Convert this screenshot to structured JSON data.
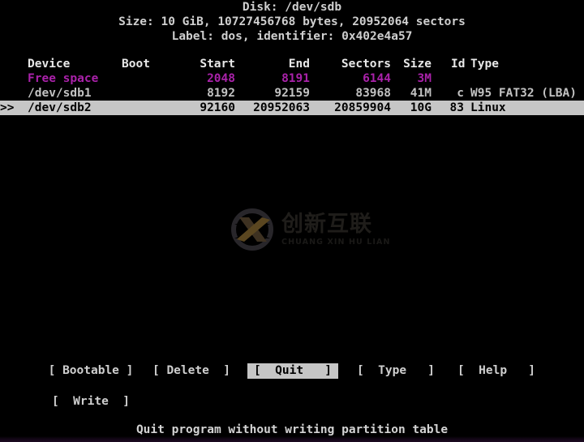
{
  "app": {
    "name": "cfdisk",
    "theme": {
      "background": "#000000",
      "foreground": "#cccccc",
      "highlight_bg": "#c6c6c6",
      "highlight_fg": "#000000",
      "free_space_fg": "#aa22aa"
    }
  },
  "header": {
    "disk_line": "Disk: /dev/sdb",
    "size_line": "Size: 10 GiB, 10727456768 bytes, 20952064 sectors",
    "label_line": "Label: dos, identifier: 0x402e4a57",
    "disk_path": "/dev/sdb",
    "size_human": "10 GiB",
    "size_bytes": "10727456768",
    "sectors_total": "20952064",
    "label_type": "dos",
    "identifier": "0x402e4a57"
  },
  "table": {
    "columns": {
      "device": "Device",
      "boot": "Boot",
      "start": "Start",
      "end": "End",
      "sectors": "Sectors",
      "size": "Size",
      "id": "Id",
      "type": "Type"
    },
    "rows": [
      {
        "marker": "",
        "device": "Free space",
        "boot": "",
        "start": "2048",
        "end": "8191",
        "sectors": "6144",
        "size": "3M",
        "id": "",
        "type": "",
        "style": "free"
      },
      {
        "marker": "",
        "device": "/dev/sdb1",
        "boot": "",
        "start": "8192",
        "end": "92159",
        "sectors": "83968",
        "size": "41M",
        "id": "c",
        "type": "W95 FAT32 (LBA)",
        "style": "norm"
      },
      {
        "marker": ">>",
        "device": "/dev/sdb2",
        "boot": "",
        "start": "92160",
        "end": "20952063",
        "sectors": "20859904",
        "size": "10G",
        "id": "83",
        "type": "Linux",
        "style": "selected"
      }
    ]
  },
  "menu": {
    "bootable": "[ Bootable ]",
    "delete": "[ Delete  ]",
    "quit": "[  Quit   ]",
    "type": "[  Type   ]",
    "help": "[  Help   ]",
    "write": "[  Write  ]",
    "selected": "quit"
  },
  "status": {
    "hint": "Quit program without writing partition table"
  },
  "watermark": {
    "cn_text": "创新互联",
    "pinyin_text": "CHUANG XIN HU LIAN",
    "mark_icon": "circle-x-logo-icon"
  }
}
